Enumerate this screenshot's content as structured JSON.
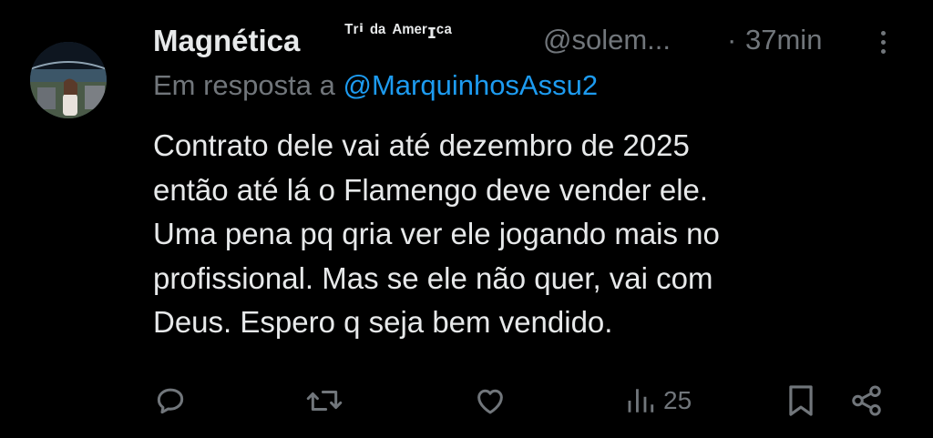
{
  "tweet": {
    "author_name": "Magnética",
    "author_name_suffix": "ᵀʳⁱ ᵈᵃ ᴬᵐᵉʳɪᶜᵃ",
    "handle": "@solem...",
    "separator": "·",
    "time": "37min",
    "reply_prefix": "Em resposta a ",
    "reply_mention": "@MarquinhosAssu2",
    "text_lines": [
      "Contrato dele vai até dezembro de 2025",
      "então até lá o Flamengo deve vender ele.",
      "Uma pena pq qria ver ele jogando mais no",
      "profissional. Mas se ele não quer, vai com",
      "Deus. Espero q seja bem vendido."
    ],
    "views": "25"
  },
  "icons": {
    "more": "more-vertical-icon",
    "reply": "reply-icon",
    "retweet": "retweet-icon",
    "like": "heart-icon",
    "views": "views-icon",
    "bookmark": "bookmark-icon",
    "share": "share-icon"
  },
  "colors": {
    "background": "#000000",
    "text": "#e7e9ea",
    "muted": "#71767b",
    "accent": "#1d9bf0"
  }
}
